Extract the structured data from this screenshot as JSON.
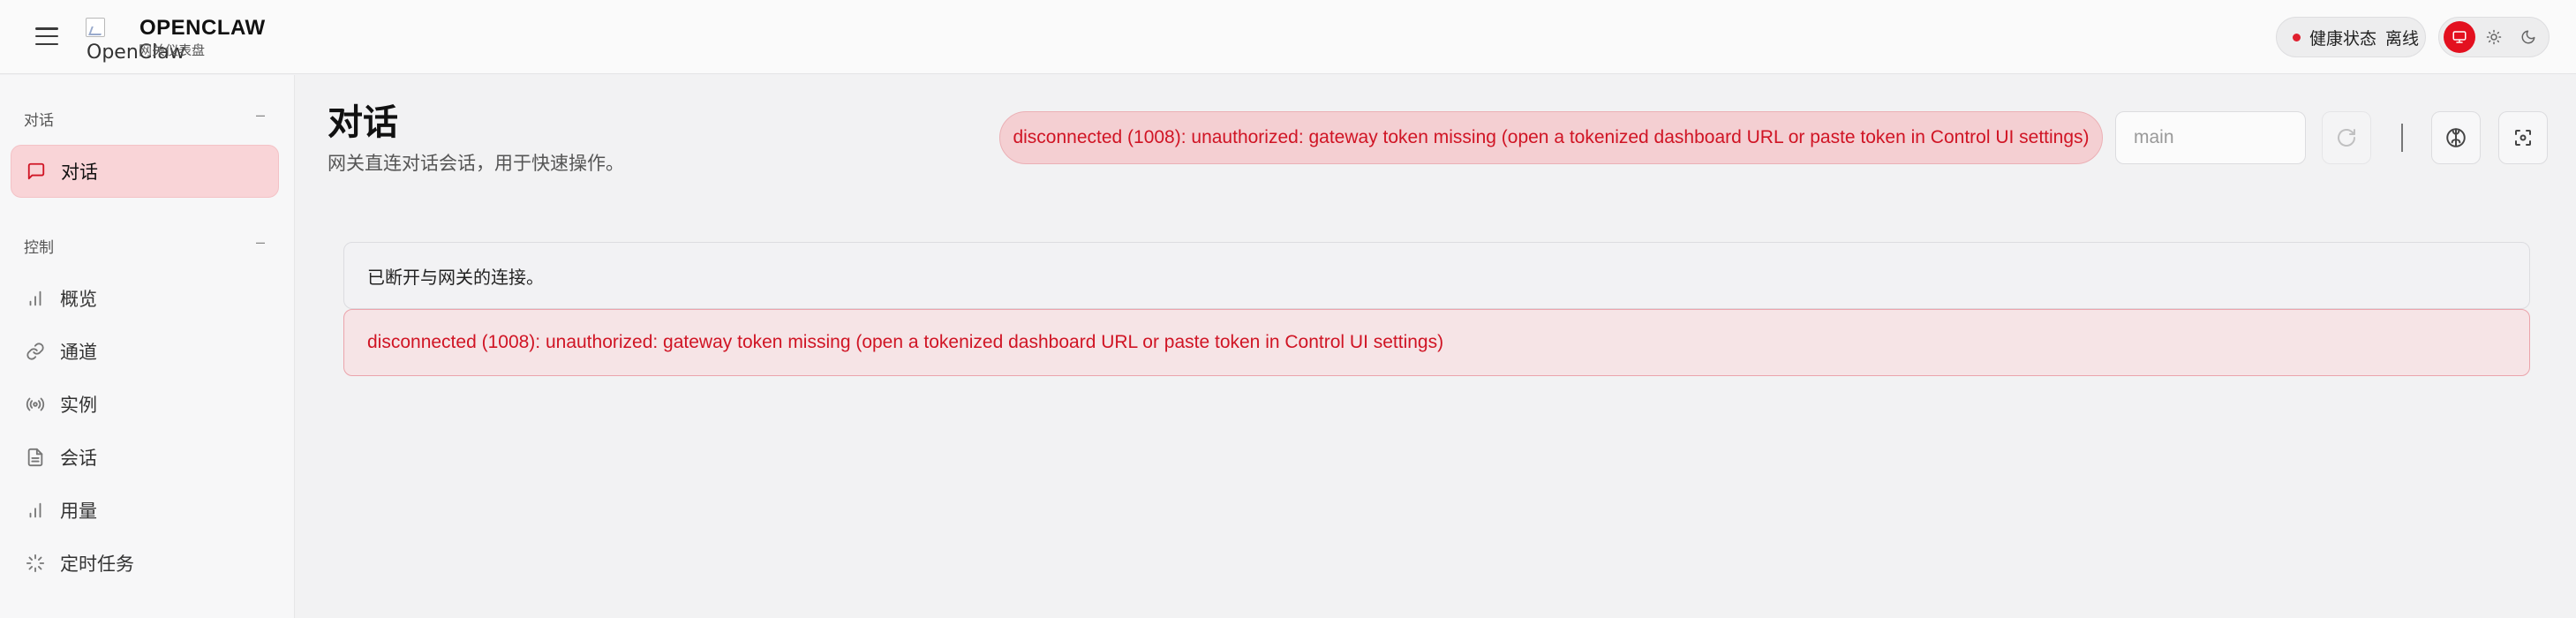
{
  "header": {
    "brand_title": "OPENCLAW",
    "brand_subtitle": "网关仪表盘",
    "logo_alt": "OpenClaw",
    "health_label": "健康状态",
    "health_status": "离线",
    "status_color": "#e0202f",
    "theme_modes": [
      "monitor-icon",
      "sun-icon",
      "moon-icon"
    ],
    "active_theme": "monitor"
  },
  "sidebar": {
    "groups": [
      {
        "label": "对话",
        "collapse": "–",
        "items": [
          {
            "label": "对话",
            "icon": "message-icon",
            "active": true
          }
        ]
      },
      {
        "label": "控制",
        "collapse": "–",
        "items": [
          {
            "label": "概览",
            "icon": "bar-chart-icon",
            "active": false
          },
          {
            "label": "通道",
            "icon": "link-icon",
            "active": false
          },
          {
            "label": "实例",
            "icon": "radio-icon",
            "active": false
          },
          {
            "label": "会话",
            "icon": "file-icon",
            "active": false
          },
          {
            "label": "用量",
            "icon": "bar-chart-icon",
            "active": false
          },
          {
            "label": "定时任务",
            "icon": "loader-icon",
            "active": false
          }
        ]
      }
    ]
  },
  "main": {
    "title": "对话",
    "subtitle": "网关直连对话会话，用于快速操作。",
    "error_banner": "disconnected (1008): unauthorized: gateway token missing (open a tokenized dashboard URL or paste token in Control UI settings)",
    "session_placeholder": "main",
    "info_message": "已断开与网关的连接。",
    "error_message": "disconnected (1008): unauthorized: gateway token missing (open a tokenized dashboard URL or paste token in Control UI settings)",
    "accent_color": "#e3101f",
    "error_text_color": "#d01424"
  }
}
